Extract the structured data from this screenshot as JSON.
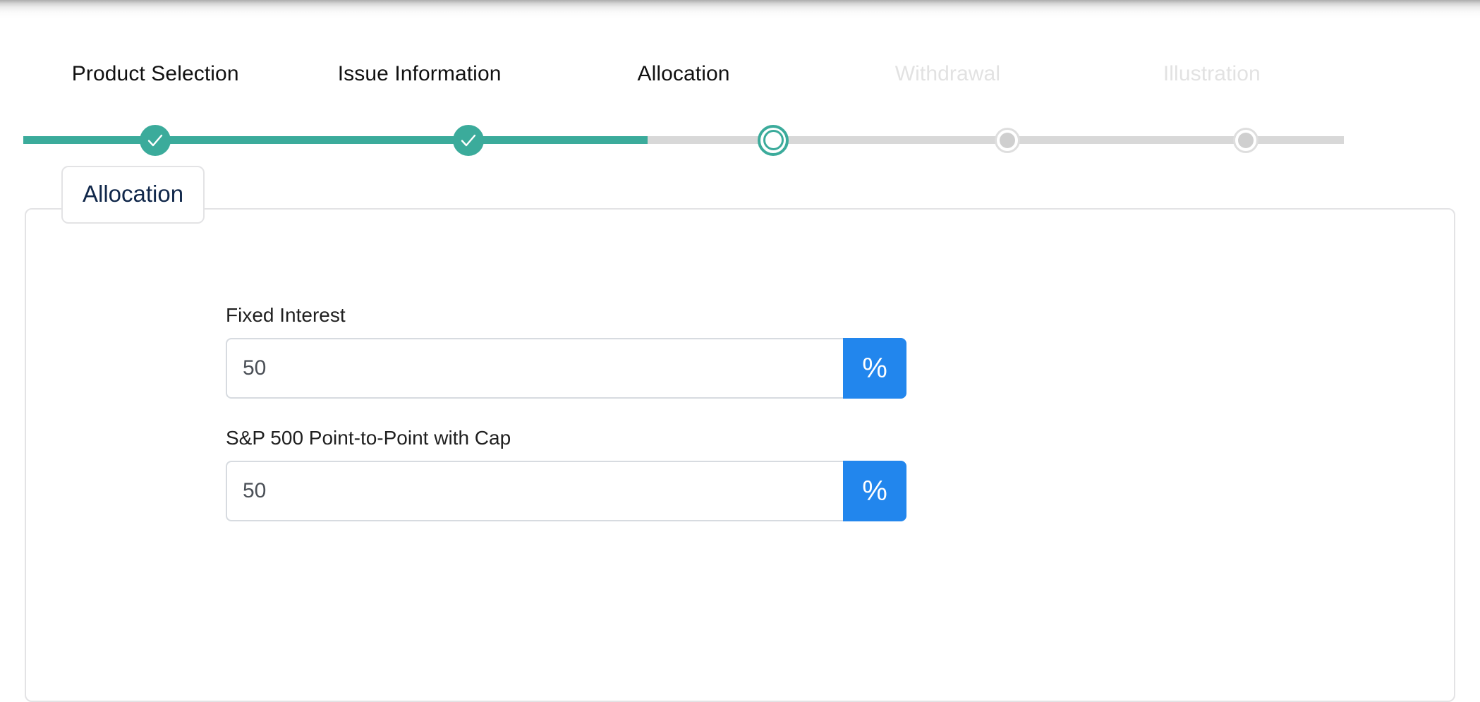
{
  "stepper": {
    "steps": [
      {
        "label": "Product Selection",
        "state": "done",
        "icon": "check-icon"
      },
      {
        "label": "Issue Information",
        "state": "done",
        "icon": "check-icon"
      },
      {
        "label": "Allocation",
        "state": "active",
        "icon": "ring-icon"
      },
      {
        "label": "Withdrawal",
        "state": "upcoming",
        "icon": "dot-icon"
      },
      {
        "label": "Illustration",
        "state": "upcoming",
        "icon": "dot-icon"
      }
    ],
    "progress_percent": 47,
    "colors": {
      "complete": "#3bab9b",
      "track": "#d8d8d8",
      "upcoming_text": "#e2e2e2",
      "active_text": "#111111"
    }
  },
  "panel": {
    "legend": "Allocation",
    "legend_color": "#10274a",
    "border_color": "#e3e3e5"
  },
  "form": {
    "fields": [
      {
        "label": "Fixed Interest",
        "value": "50",
        "placeholder": "50",
        "unit_label": "%",
        "unit_icon": "percent-icon"
      },
      {
        "label": "S&P 500 Point-to-Point with Cap",
        "value": "50",
        "placeholder": "50",
        "unit_label": "%",
        "unit_icon": "percent-icon"
      }
    ],
    "accent_color": "#2286ed"
  }
}
